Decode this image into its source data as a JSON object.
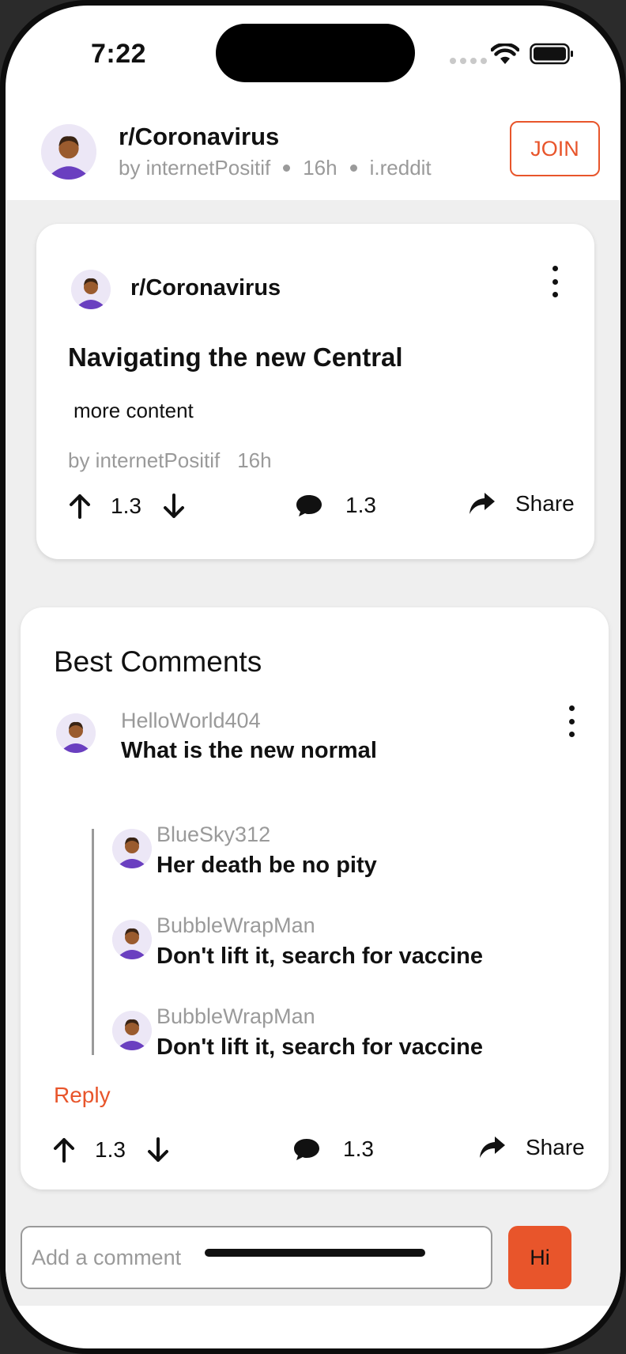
{
  "status_bar": {
    "time": "7:22"
  },
  "header": {
    "subreddit": "r/Coronavirus",
    "author": "by internetPositif",
    "age": "16h",
    "source": "i.reddit",
    "join_label": "JOIN"
  },
  "post": {
    "subreddit": "r/Coronavirus",
    "title": "Navigating the new Central",
    "content": "more content",
    "author": "by internetPositif",
    "age": "16h",
    "upvotes": "1.3",
    "comments": "1.3",
    "share_label": "Share"
  },
  "comments": {
    "heading": "Best Comments",
    "top": {
      "user": "HelloWorld404",
      "text": "What is the new normal"
    },
    "replies": [
      {
        "user": "BlueSky312",
        "text": "Her death be no pity"
      },
      {
        "user": "BubbleWrapMan",
        "text": "Don't lift it, search for vaccine"
      },
      {
        "user": "BubbleWrapMan",
        "text": "Don't lift it, search for vaccine"
      }
    ],
    "reply_label": "Reply",
    "upvotes": "1.3",
    "comments": "1.3",
    "share_label": "Share"
  },
  "composer": {
    "placeholder": "Add a comment",
    "send_label": "Hi"
  },
  "colors": {
    "accent": "#e8552b",
    "muted": "#9a9a9a",
    "feed_bg": "#efefef"
  },
  "icons": [
    "avatar",
    "kebab-menu-icon",
    "upvote-arrow-icon",
    "downvote-arrow-icon",
    "comment-bubble-icon",
    "share-arrow-icon",
    "wifi-icon",
    "battery-icon"
  ]
}
